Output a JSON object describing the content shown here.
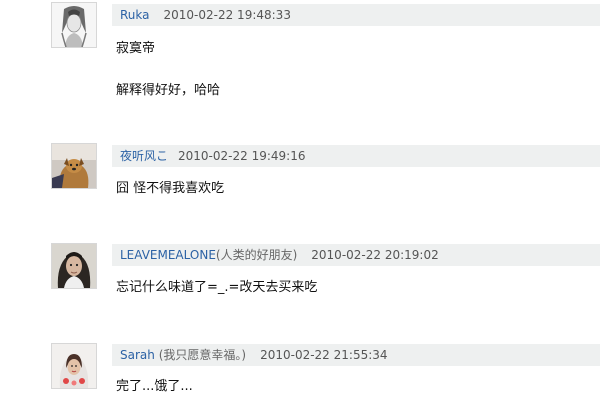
{
  "comments": [
    {
      "username": "Ruka",
      "signature": "",
      "timestamp": "2010-02-22 19:48:33",
      "lines": [
        "寂寞帝",
        "解释得好好，哈哈"
      ],
      "avatar_icon": "girl-sketch-avatar"
    },
    {
      "username": "夜听风こ",
      "signature": "",
      "timestamp": "2010-02-22 19:49:16",
      "lines": [
        "囧 怪不得我喜欢吃"
      ],
      "avatar_icon": "dog-photo-avatar"
    },
    {
      "username": "LEAVEMEALONE",
      "signature": "(人类的好朋友)",
      "timestamp": "2010-02-22 20:19:02",
      "lines": [
        "忘记什么味道了=_.=改天去买来吃"
      ],
      "avatar_icon": "portrait-photo-avatar"
    },
    {
      "username": "Sarah",
      "signature": "(我只愿意幸福。)",
      "timestamp": "2010-02-22 21:55:34",
      "lines": [
        "完了...饿了..."
      ],
      "avatar_icon": "bride-photo-avatar"
    }
  ]
}
